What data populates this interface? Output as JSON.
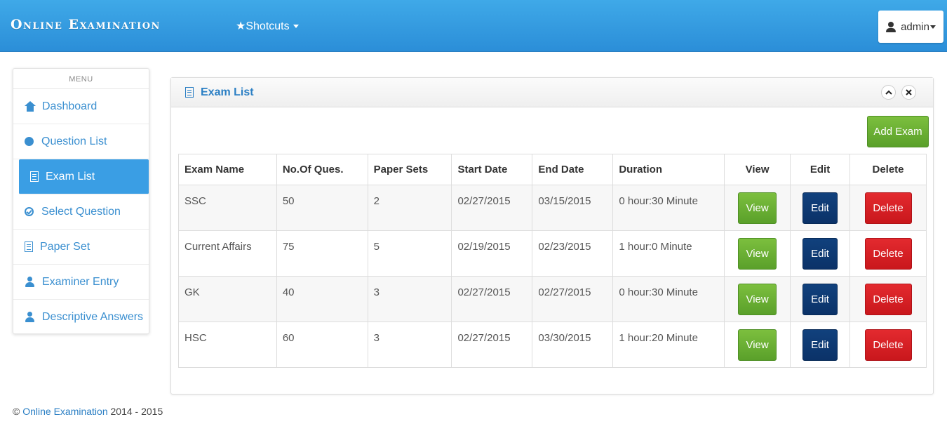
{
  "header": {
    "brand": "Online Examination",
    "shortcuts_label": "★Shotcuts",
    "user_label": "admin"
  },
  "sidebar": {
    "title": "MENU",
    "items": [
      {
        "label": "Dashboard",
        "icon": "home-icon"
      },
      {
        "label": "Question List",
        "icon": "question-circle-icon"
      },
      {
        "label": "Exam List",
        "icon": "list-icon",
        "active": true
      },
      {
        "label": "Select Question",
        "icon": "check-circle-icon"
      },
      {
        "label": "Paper Set",
        "icon": "list-icon"
      },
      {
        "label": "Examiner Entry",
        "icon": "user-icon"
      },
      {
        "label": "Descriptive Answers",
        "icon": "user-icon"
      }
    ]
  },
  "panel": {
    "title": "Exam List",
    "add_button": "Add Exam",
    "columns": [
      "Exam Name",
      "No.Of Ques.",
      "Paper Sets",
      "Start Date",
      "End Date",
      "Duration",
      "View",
      "Edit",
      "Delete"
    ],
    "rows": [
      {
        "name": "SSC",
        "questions": "50",
        "paper_sets": "2",
        "start": "02/27/2015",
        "end": "03/15/2015",
        "duration": "0 hour:30 Minute"
      },
      {
        "name": "Current Affairs",
        "questions": "75",
        "paper_sets": "5",
        "start": "02/19/2015",
        "end": "02/23/2015",
        "duration": "1 hour:0 Minute"
      },
      {
        "name": "GK",
        "questions": "40",
        "paper_sets": "3",
        "start": "02/27/2015",
        "end": "02/27/2015",
        "duration": "0 hour:30 Minute"
      },
      {
        "name": "HSC",
        "questions": "60",
        "paper_sets": "3",
        "start": "02/27/2015",
        "end": "03/30/2015",
        "duration": "1 hour:20 Minute"
      }
    ],
    "view_label": "View",
    "edit_label": "Edit",
    "delete_label": "Delete"
  },
  "footer": {
    "copyright": "©",
    "link_text": "Online Examination",
    "years": "2014 - 2015"
  },
  "colors": {
    "navbar": "#2b8ed8",
    "accent": "#3a9ee4",
    "view_button": "#5aa02a",
    "edit_button": "#0b3268",
    "delete_button": "#c9171c"
  }
}
